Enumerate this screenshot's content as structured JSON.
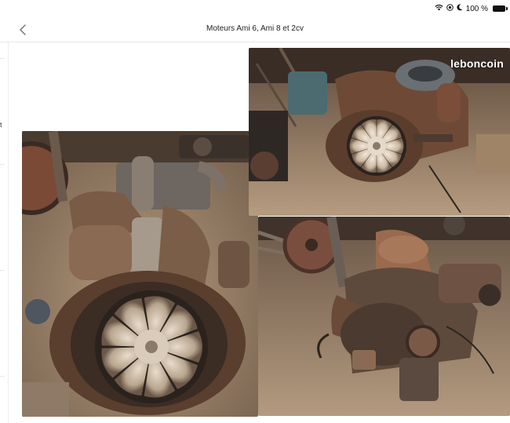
{
  "status_bar": {
    "battery_text": "100 %",
    "icons": [
      "wifi-icon",
      "location-icon",
      "moon-icon",
      "battery-icon"
    ]
  },
  "header": {
    "title": "Moteurs Ami 6, Ami 8 et 2cv",
    "back_icon": "chevron-left-icon"
  },
  "left_edge": {
    "visible_char": "t"
  },
  "photos": [
    {
      "id": "main",
      "subject": "engine-front-view"
    },
    {
      "id": "top",
      "subject": "engine-fan-view",
      "watermark": "leboncoin"
    },
    {
      "id": "bottom",
      "subject": "engine-side-view"
    }
  ],
  "colors": {
    "rust": "#8a5a3a",
    "dust": "#9a8570",
    "dark": "#2b2420",
    "watermark": "#ffffff"
  }
}
